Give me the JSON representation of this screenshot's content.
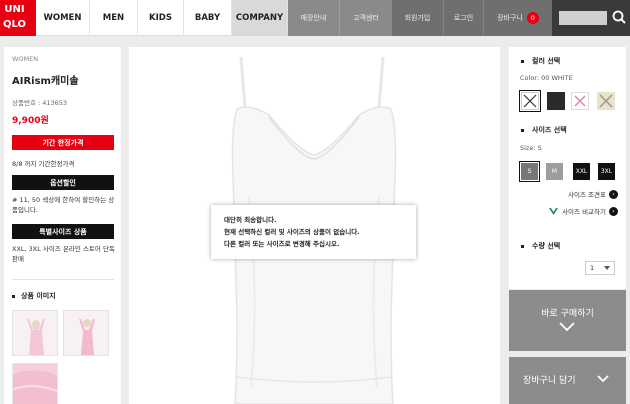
{
  "logo": {
    "letters": [
      "UNI",
      "",
      "QLO",
      ""
    ]
  },
  "nav": {
    "women": "WOMEN",
    "men": "MEN",
    "kids": "KIDS",
    "baby": "BABY",
    "company": "COMPANY",
    "store": "매장안내",
    "support": "고객센터",
    "signup": "회원가입",
    "login": "로그인",
    "cart": "장바구니",
    "cart_count": "0"
  },
  "product": {
    "category": "WOMEN",
    "name": "AIRism캐미솔",
    "number": "상품번호 : 413653",
    "price": "9,900원",
    "limited_badge": "기간 한정가격",
    "limited_note": "8/8 까지 기간한정가격",
    "option_badge": "옵션할인",
    "option_note": "# 11, 50 색상에 한하여 할인하는 상품입니다.",
    "special_badge": "특별사이즈 상품",
    "special_note": "XXL, 3XL 사이즈 온라인 스토어 단독 판매",
    "images_title": "상품 이미지"
  },
  "popup": {
    "line1": "대단히 죄송합니다.",
    "line2": "현재 선택하신 컬러 및 사이즈의 상품이 없습니다.",
    "line3": "다른 컬러 또는 사이즈로 변경해 주십시오."
  },
  "options": {
    "color_title": "컬러 선택",
    "color_selected": "Color: 00 WHITE",
    "size_title": "사이즈 선택",
    "size_selected": "Size: S",
    "sizes": [
      "S",
      "M",
      "XXL",
      "3XL"
    ],
    "size_chart": "사이즈 조견표",
    "size_compare": "사이즈 비교하기",
    "qty_title": "수량 선택",
    "qty_value": "1"
  },
  "actions": {
    "buy": "바로 구매하기",
    "cart": "장바구니 담기"
  },
  "colors": {
    "brand_red": "#e60012",
    "button_gray": "#8c8c8c"
  }
}
